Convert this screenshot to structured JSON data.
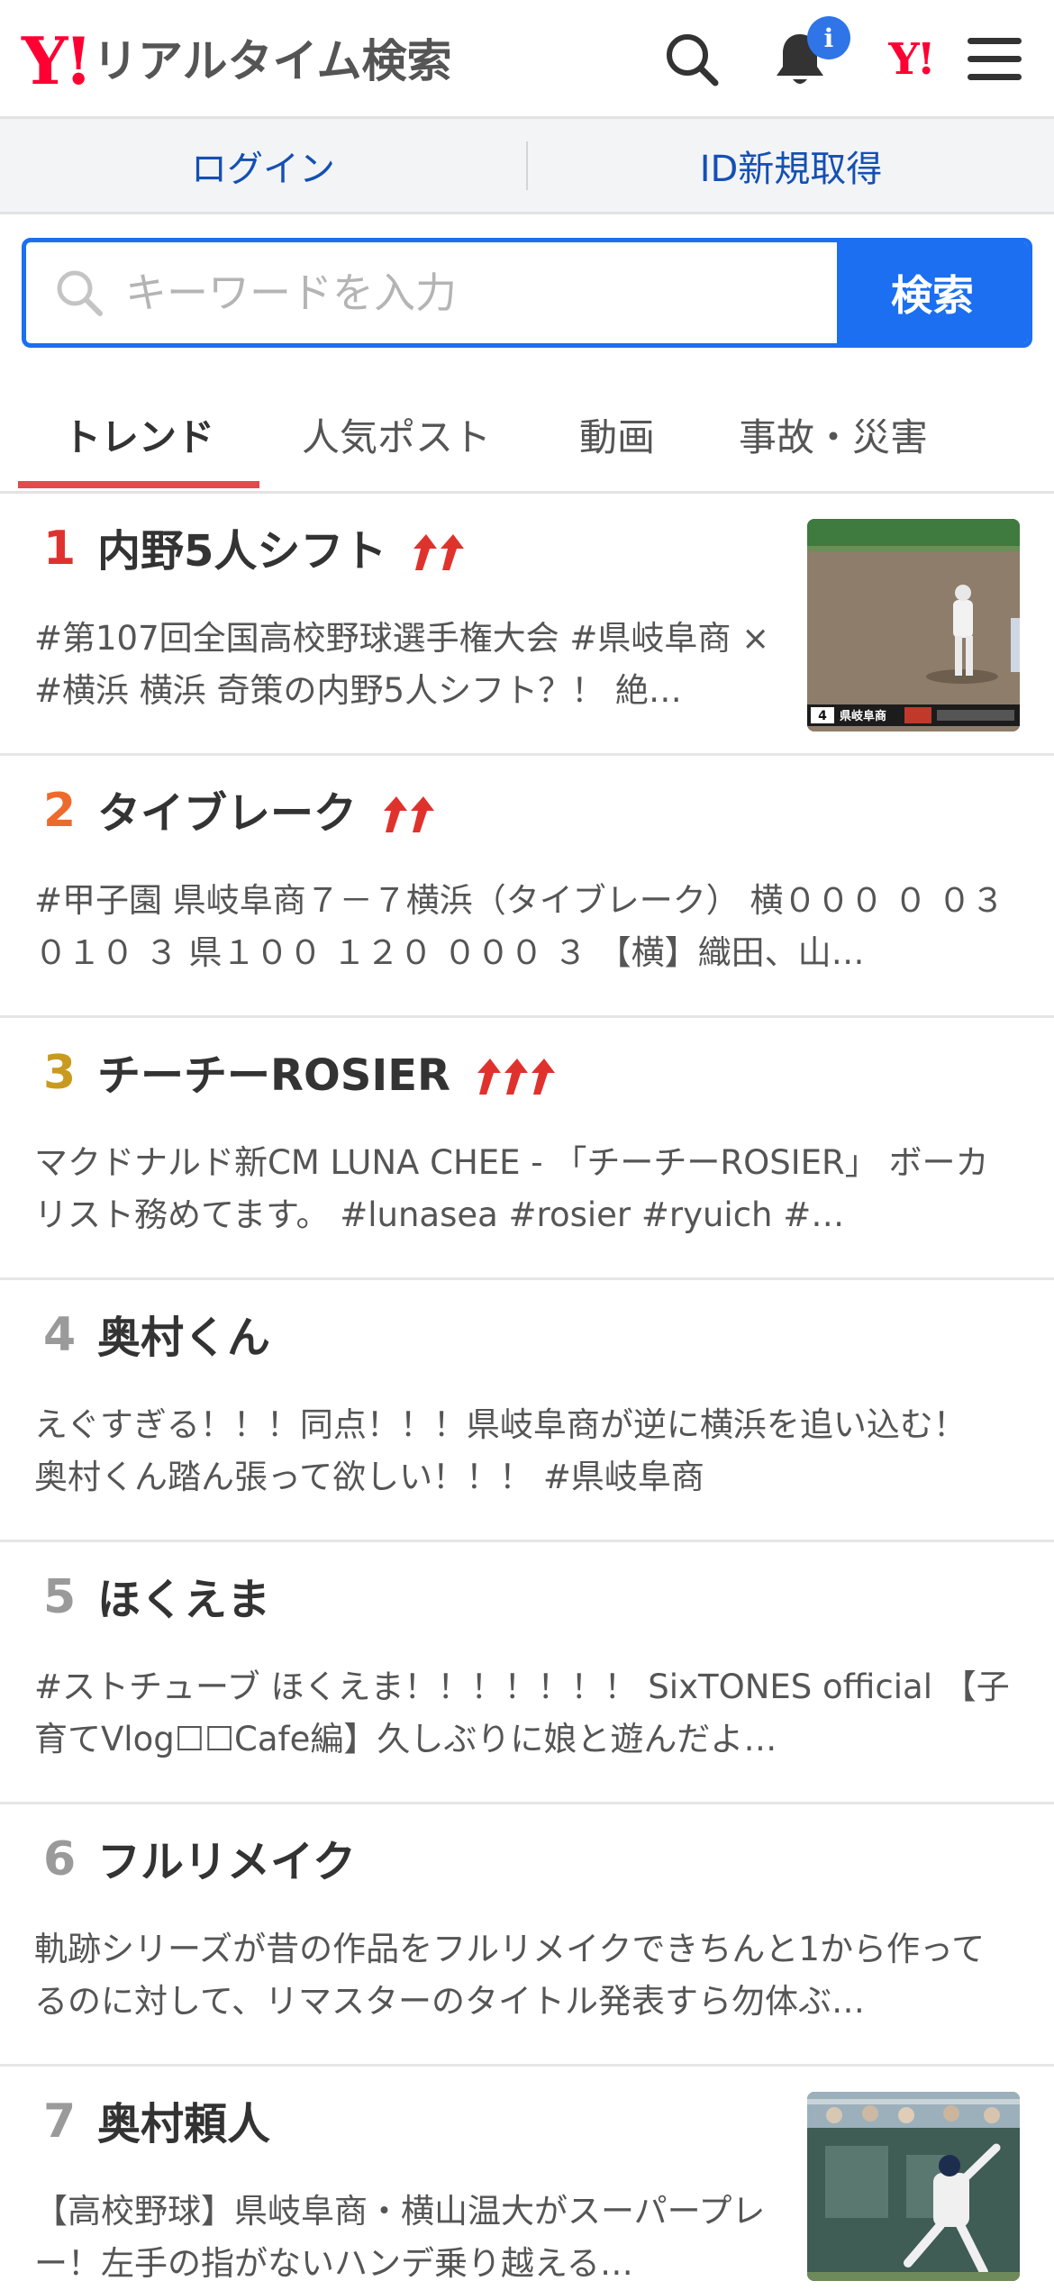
{
  "header": {
    "logo_mark": "Y!",
    "logo_text": "リアルタイム検索",
    "notification_badge": "i",
    "yahoo_mark": "Y!"
  },
  "login_bar": {
    "login": "ログイン",
    "register": "ID新規取得"
  },
  "search": {
    "placeholder": "キーワードを入力",
    "button": "検索"
  },
  "tabs": [
    "トレンド",
    "人気ポスト",
    "動画",
    "事故・災害"
  ],
  "active_tab": 0,
  "colors": {
    "accent_blue": "#1b6ff0",
    "tab_underline": "#e5484d",
    "rank1": "#e0322d",
    "rank2": "#ee6a2c",
    "rank3": "#c99a1f",
    "rank_default": "#9a9a9a",
    "arrow": "#e0322d"
  },
  "trends": [
    {
      "rank": "1",
      "keyword": "内野5人シフト",
      "arrows": 2,
      "desc": "#第107回全国高校野球選手権大会 #県岐阜商 × #横浜 横浜 奇策の内野5人シフト？！ 絶…",
      "has_thumb": true
    },
    {
      "rank": "2",
      "keyword": "タイブレーク",
      "arrows": 2,
      "desc": "#甲子園 県岐阜商７－７横浜（タイブレーク） 横０００ ０ ０３ ０１０ ３ 県１００ １２０ ０００ ３ 【横】織田、山…",
      "has_thumb": false
    },
    {
      "rank": "3",
      "keyword": "チーチーROSIER",
      "arrows": 3,
      "desc": "マクドナルド新CM LUNA CHEE - 「チーチーROSIER」 ボーカリスト務めてます。 #lunasea #rosier #ryuich #…",
      "has_thumb": false
    },
    {
      "rank": "4",
      "keyword": "奥村くん",
      "arrows": 0,
      "desc": "えぐすぎる！！！同点！！！県岐阜商が逆に横浜を追い込む！奥村くん踏ん張って欲しい！！！ #県岐阜商",
      "has_thumb": false
    },
    {
      "rank": "5",
      "keyword": "ほくえま",
      "arrows": 0,
      "desc": "#ストチューブ ほくえま！！！！！！！ SixTONES official 【子育てVlog☐☐Cafe編】久しぶりに娘と遊んだよ…",
      "has_thumb": false
    },
    {
      "rank": "6",
      "keyword": "フルリメイク",
      "arrows": 0,
      "desc": "軌跡シリーズが昔の作品をフルリメイクできちんと1から作ってるのに対して、リマスターのタイトル発表すら勿体ぶ…",
      "has_thumb": false
    },
    {
      "rank": "7",
      "keyword": "奥村頼人",
      "arrows": 0,
      "desc": "【高校野球】県岐阜商・横山温大がスーパープレー！左手の指がないハンデ乗り越える…",
      "has_thumb": true
    }
  ],
  "thumb1": {
    "scoreboard_team": "県岐阜商",
    "scoreboard_num": "4"
  }
}
